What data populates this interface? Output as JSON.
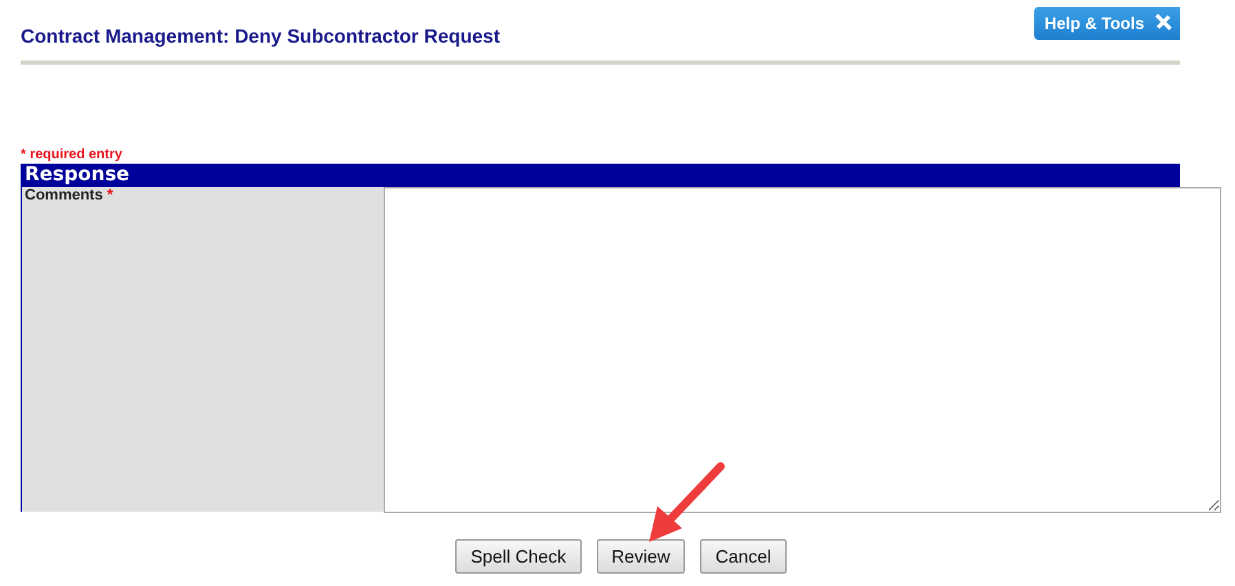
{
  "header": {
    "title": "Contract Management: Deny Subcontractor Request",
    "help_button": "Help & Tools"
  },
  "required_note": {
    "mark": "*",
    "text": "required entry"
  },
  "section": {
    "title": "Response",
    "fields": [
      {
        "label": "Comments",
        "required_mark": "*",
        "kind": "textarea"
      }
    ]
  },
  "buttons": [
    {
      "label": "Spell Check"
    },
    {
      "label": "Review"
    },
    {
      "label": "Cancel"
    }
  ]
}
